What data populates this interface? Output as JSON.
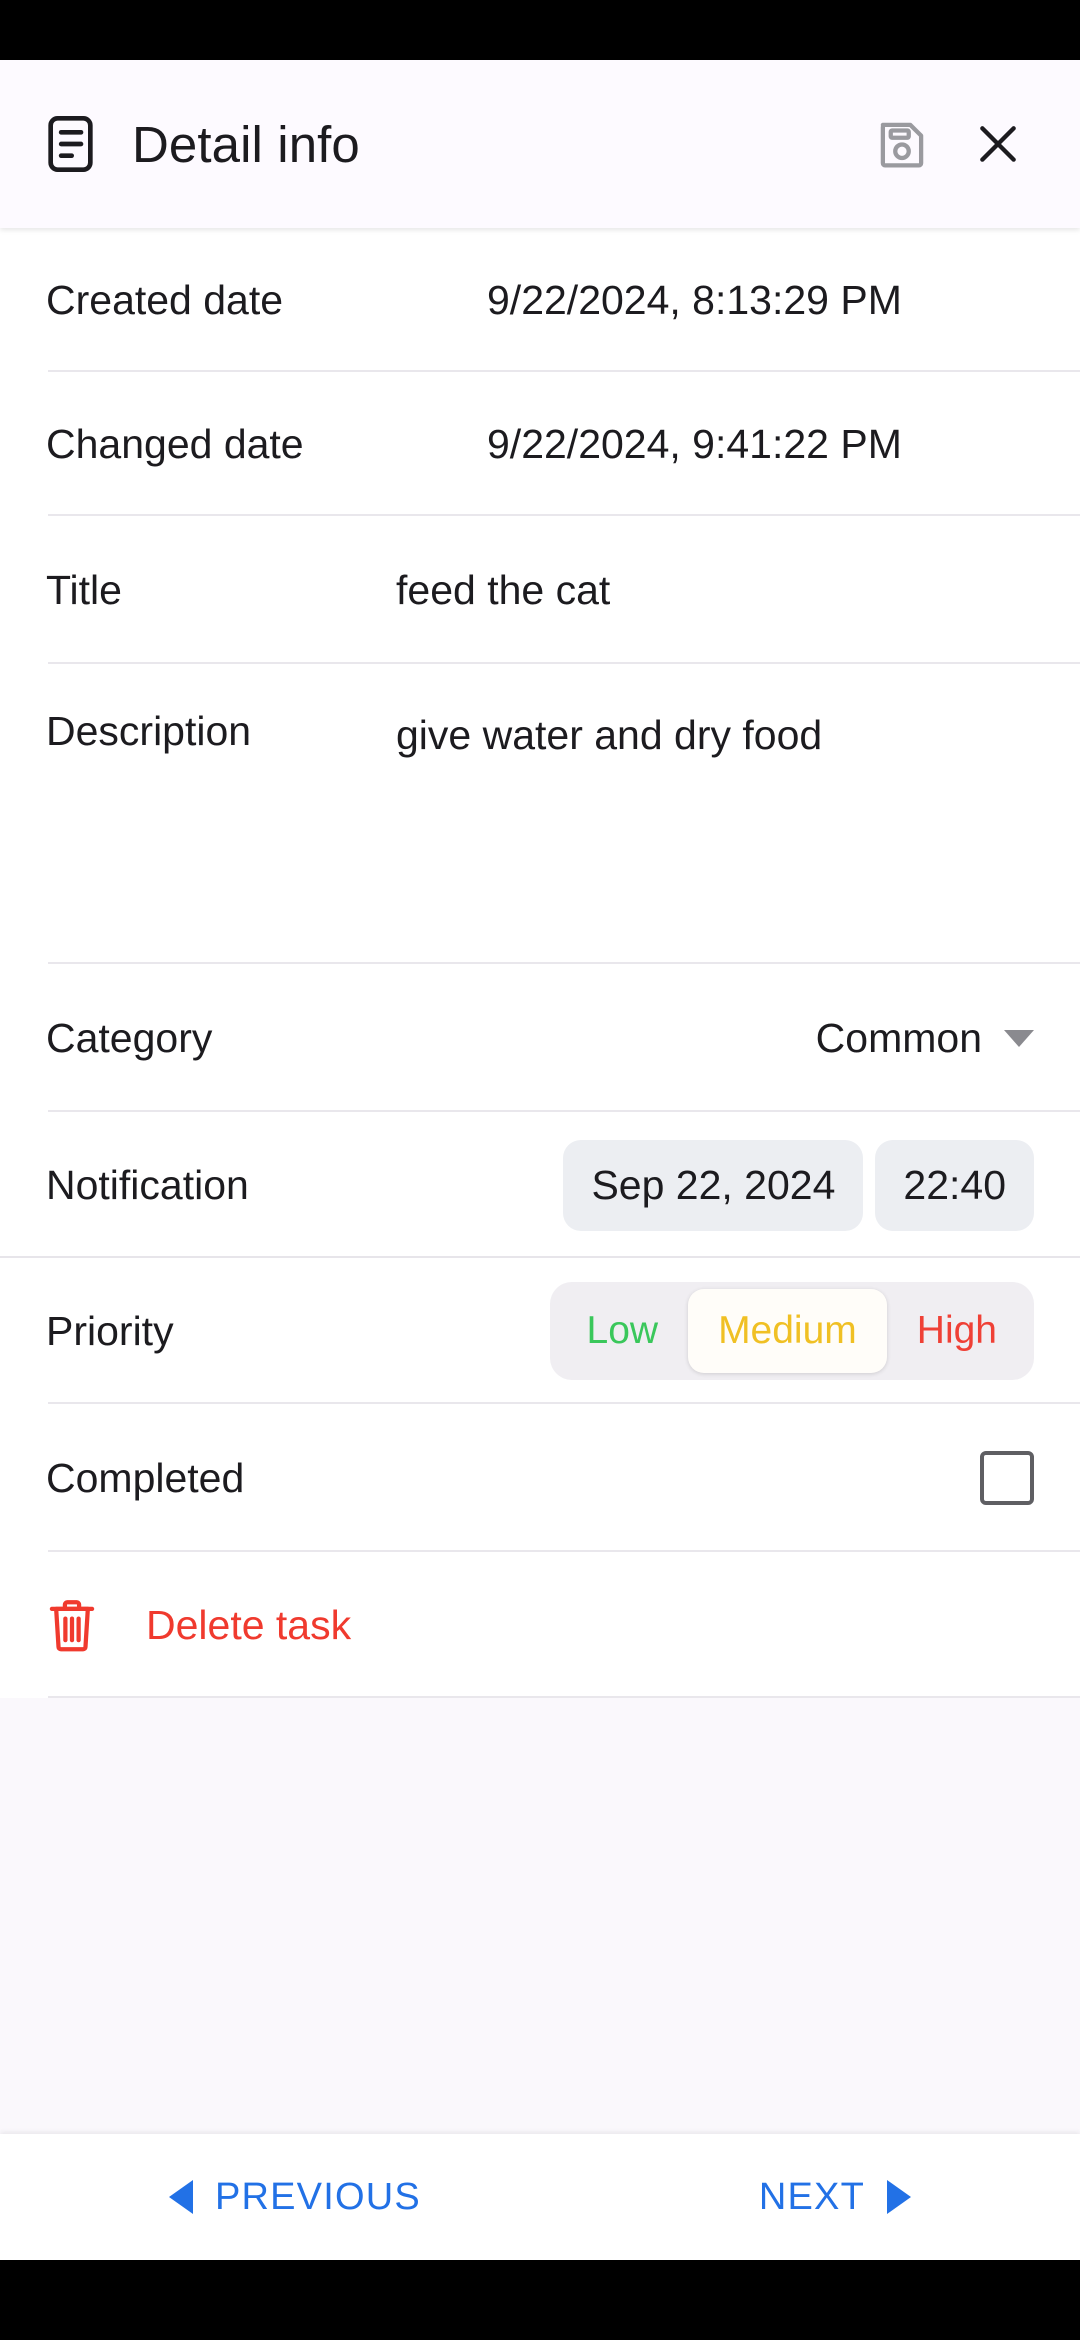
{
  "header": {
    "title": "Detail info",
    "doc_icon": "document-note-icon",
    "save_icon": "floppy-save-icon",
    "close_icon": "close-x-icon"
  },
  "fields": {
    "created_date": {
      "label": "Created date",
      "value": "9/22/2024, 8:13:29 PM"
    },
    "changed_date": {
      "label": "Changed date",
      "value": "9/22/2024, 9:41:22 PM"
    },
    "title": {
      "label": "Title",
      "value": "feed the cat"
    },
    "description": {
      "label": "Description",
      "value": "give water and dry food"
    },
    "category": {
      "label": "Category",
      "value": "Common",
      "caret_icon": "chevron-down-icon"
    },
    "notification": {
      "label": "Notification",
      "date": "Sep 22, 2024",
      "time": "22:40"
    },
    "priority": {
      "label": "Priority",
      "selected": "Medium",
      "options": [
        {
          "label": "Low",
          "color": "#3ac75b"
        },
        {
          "label": "Medium",
          "color": "#f0c024"
        },
        {
          "label": "High",
          "color": "#ef4036"
        }
      ]
    },
    "completed": {
      "label": "Completed",
      "checked": false
    }
  },
  "delete_action": {
    "label": "Delete task",
    "icon": "trash-icon",
    "color": "#f03a2e"
  },
  "bottom_nav": {
    "previous_label": "PREVIOUS",
    "next_label": "NEXT",
    "accent_color": "#2271e6",
    "prev_icon": "triangle-left-icon",
    "next_icon": "triangle-right-icon"
  }
}
